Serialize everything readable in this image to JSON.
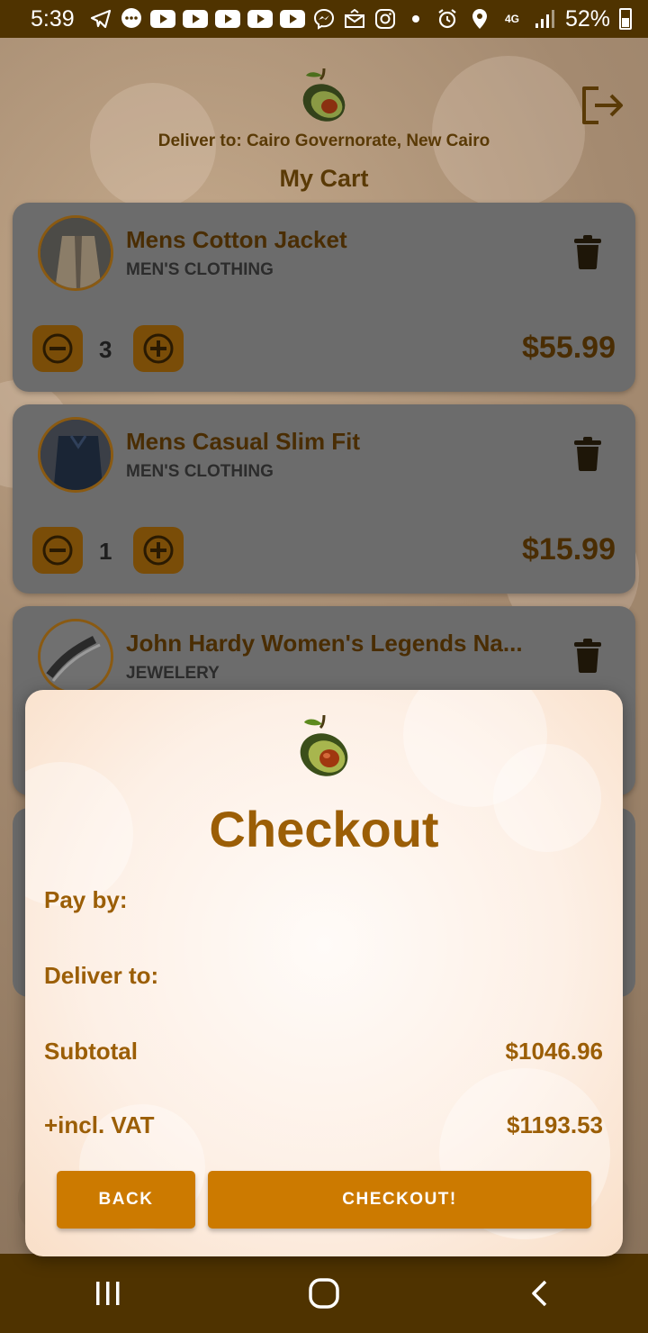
{
  "status_bar": {
    "time": "5:39",
    "network": "4G",
    "battery": "52%",
    "icons": [
      "telegram-icon",
      "messenger-icon",
      "youtube-icon",
      "youtube-icon",
      "youtube-icon",
      "youtube-icon",
      "youtube-icon",
      "messenger-icon",
      "mail-icon",
      "instagram-icon",
      "dot-icon",
      "alarm-icon",
      "location-icon",
      "signal-icon",
      "battery-icon"
    ]
  },
  "header": {
    "deliver_to": "Deliver to: Cairo Governorate, New Cairo",
    "cart_title": "My Cart"
  },
  "cart": {
    "items": [
      {
        "name": "Mens Cotton Jacket",
        "category": "MEN'S CLOTHING",
        "quantity": "3",
        "price": "$55.99"
      },
      {
        "name": "Mens Casual Slim Fit",
        "category": "MEN'S CLOTHING",
        "quantity": "1",
        "price": "$15.99"
      },
      {
        "name": "John Hardy Women's Legends Na...",
        "category": "JEWELERY"
      }
    ]
  },
  "checkout_dialog": {
    "title": "Checkout",
    "pay_by_label": "Pay by:",
    "deliver_to_label": "Deliver to:",
    "subtotal_label": "Subtotal",
    "subtotal_value": "$1046.96",
    "vat_label": "+incl. VAT",
    "vat_value": "$1193.53",
    "back_label": "BACK",
    "checkout_label": "CHECKOUT!"
  },
  "colors": {
    "brand_dark": "#4f3300",
    "accent": "#cc7a00",
    "dialog_text": "#9b5e06"
  }
}
